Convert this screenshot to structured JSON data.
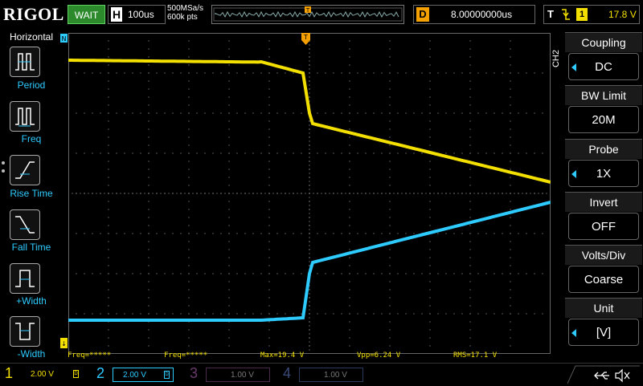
{
  "top": {
    "logo": "RIGOL",
    "run_status": "WAIT",
    "horizontal_letter": "H",
    "timebase": "100us",
    "sample_rate": "500MSa/s",
    "memory_depth": "600k pts",
    "delay_letter": "D",
    "delay_value": "8.00000000us",
    "trigger_letter": "T",
    "trigger_source": "1",
    "trigger_level": "17.8 V"
  },
  "left_menu": {
    "title": "Horizontal",
    "items": [
      {
        "label": "Period",
        "icon": "period-icon"
      },
      {
        "label": "Freq",
        "icon": "frequency-icon"
      },
      {
        "label": "Rise Time",
        "icon": "rise-time-icon"
      },
      {
        "label": "Fall Time",
        "icon": "fall-time-icon"
      },
      {
        "label": "+Width",
        "icon": "positive-width-icon"
      },
      {
        "label": "-Width",
        "icon": "negative-width-icon"
      }
    ]
  },
  "measurements": {
    "freq1": "Freq=*****",
    "freq2": "Freq=*****",
    "max": "Max=19.4 V",
    "vpp": "Vpp=6.24 V",
    "rms": "RMS=17.1 V"
  },
  "right_menu": {
    "channel_tag": "CH2",
    "items": [
      {
        "title": "Coupling",
        "value": "DC",
        "has_arrow": true
      },
      {
        "title": "BW Limit",
        "value": "20M",
        "has_arrow": false
      },
      {
        "title": "Probe",
        "value": "1X",
        "has_arrow": true
      },
      {
        "title": "Invert",
        "value": "OFF",
        "has_arrow": false
      },
      {
        "title": "Volts/Div",
        "value": "Coarse",
        "has_arrow": false
      },
      {
        "title": "Unit",
        "value": "[V]",
        "has_arrow": true
      }
    ]
  },
  "channels": [
    {
      "num": "1",
      "scale": "2.00 V",
      "color": "#f4e000",
      "active": true
    },
    {
      "num": "2",
      "scale": "2.00 V",
      "color": "#2ecbff",
      "active": true
    },
    {
      "num": "3",
      "scale": "1.00 V",
      "color": "#c040c0",
      "active": false
    },
    {
      "num": "4",
      "scale": "1.00 V",
      "color": "#3060ff",
      "active": false
    }
  ],
  "colors": {
    "ch1": "#f4e000",
    "ch2": "#2ecbff",
    "trigger_marker": "#f4a000",
    "menu_accent": "#2ecbff"
  }
}
